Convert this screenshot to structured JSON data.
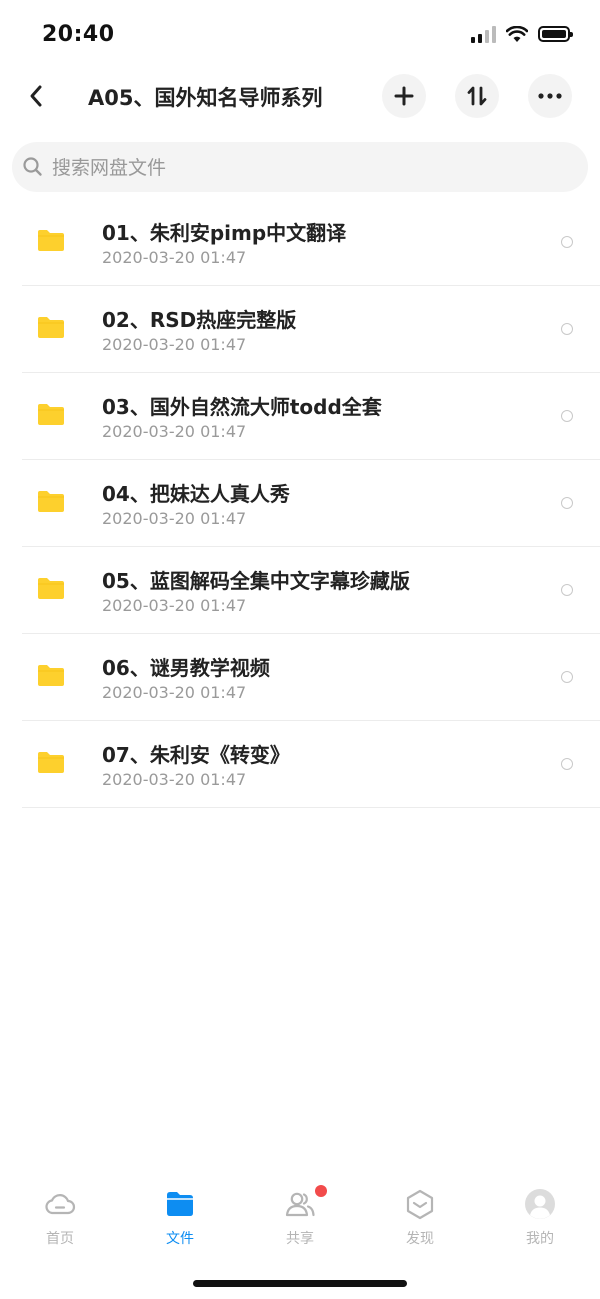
{
  "status_bar": {
    "time": "20:40"
  },
  "header": {
    "title": "A05、国外知名导师系列"
  },
  "search": {
    "placeholder": "搜索网盘文件"
  },
  "files": [
    {
      "name": "01、朱利安pimp中文翻译",
      "date": "2020-03-20 01:47"
    },
    {
      "name": "02、RSD热座完整版",
      "date": "2020-03-20 01:47"
    },
    {
      "name": "03、国外自然流大师todd全套",
      "date": "2020-03-20 01:47"
    },
    {
      "name": "04、把妹达人真人秀",
      "date": "2020-03-20 01:47"
    },
    {
      "name": "05、蓝图解码全集中文字幕珍藏版",
      "date": "2020-03-20 01:47"
    },
    {
      "name": "06、谜男教学视频",
      "date": "2020-03-20 01:47"
    },
    {
      "name": "07、朱利安《转变》",
      "date": "2020-03-20 01:47"
    }
  ],
  "tabs": [
    {
      "label": "首页",
      "icon": "cloud-icon"
    },
    {
      "label": "文件",
      "icon": "folder-icon"
    },
    {
      "label": "共享",
      "icon": "people-icon"
    },
    {
      "label": "发现",
      "icon": "discover-icon"
    },
    {
      "label": "我的",
      "icon": "avatar-icon"
    }
  ],
  "colors": {
    "accent": "#0d8df2",
    "folder": "#fdd02d",
    "badge": "#f24b4b"
  }
}
